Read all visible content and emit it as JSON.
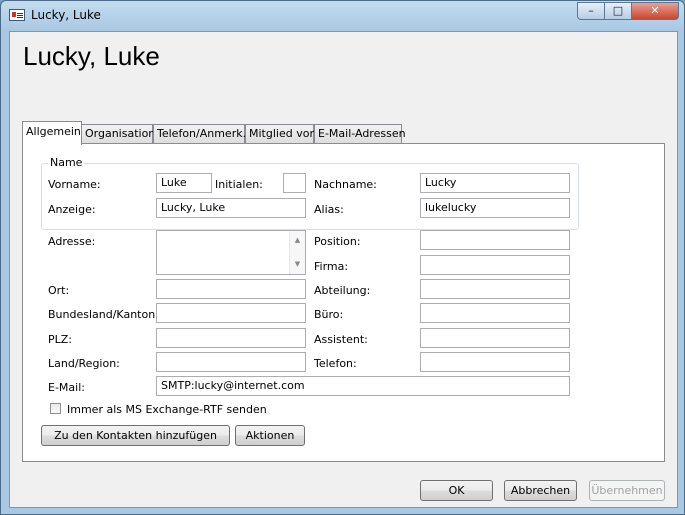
{
  "window": {
    "title": "Lucky, Luke",
    "min_glyph": "–",
    "max_glyph": "□",
    "close_glyph": "✕"
  },
  "header": {
    "display_name": "Lucky, Luke"
  },
  "tabs": [
    {
      "label": "Allgemein"
    },
    {
      "label": "Organisation"
    },
    {
      "label": "Telefon/Anmerk."
    },
    {
      "label": "Mitglied von"
    },
    {
      "label": "E-Mail-Adressen"
    }
  ],
  "name_group": {
    "title": "Name",
    "vorname_label": "Vorname:",
    "vorname": "Luke",
    "initialen_label": "Initialen:",
    "initialen": "",
    "nachname_label": "Nachname:",
    "nachname": "Lucky",
    "anzeige_label": "Anzeige:",
    "anzeige": "Lucky, Luke",
    "alias_label": "Alias:",
    "alias": "lukelucky"
  },
  "address": {
    "adresse_label": "Adresse:",
    "adresse": "",
    "ort_label": "Ort:",
    "ort": "",
    "bundesland_label": "Bundesland/Kanton:",
    "bundesland": "",
    "plz_label": "PLZ:",
    "plz": "",
    "land_label": "Land/Region:",
    "land": ""
  },
  "org": {
    "position_label": "Position:",
    "position": "",
    "firma_label": "Firma:",
    "firma": "",
    "abteilung_label": "Abteilung:",
    "abteilung": "",
    "buero_label": "Büro:",
    "buero": "",
    "assistent_label": "Assistent:",
    "assistent": "",
    "telefon_label": "Telefon:",
    "telefon": ""
  },
  "email": {
    "label": "E-Mail:",
    "value": "SMTP:lucky@internet.com"
  },
  "rtf_checkbox": {
    "label": "Immer als MS Exchange-RTF senden",
    "checked": false
  },
  "buttons": {
    "add_contacts": "Zu den Kontakten hinzufügen",
    "actions": "Aktionen",
    "ok": "OK",
    "cancel": "Abbrechen",
    "apply": "Übernehmen"
  }
}
